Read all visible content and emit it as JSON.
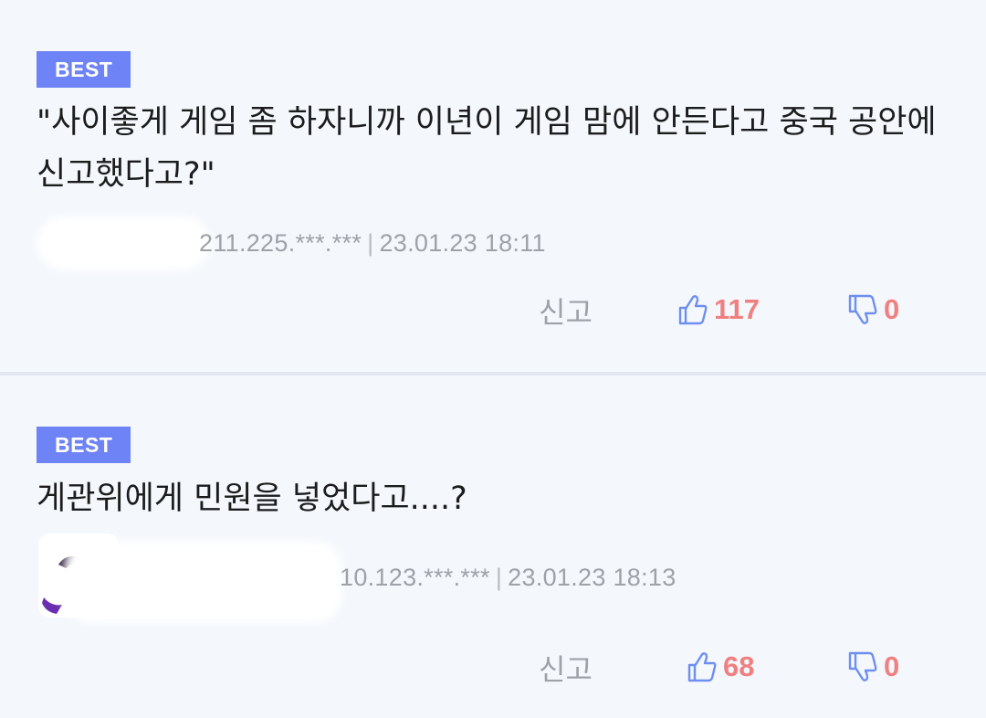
{
  "comments": [
    {
      "badge": "BEST",
      "text": "\"사이좋게 게임 좀 하자니까 이년이 게임 맘에 안든다고 중국 공안에 신고했다고?\"",
      "ip": "211.225.***.***",
      "separator": "|",
      "datetime": "23.01.23 18:11",
      "report_label": "신고",
      "likes": "117",
      "dislikes": "0"
    },
    {
      "badge": "BEST",
      "text": "게관위에게 민원을 넣었다고....?",
      "ip": "10.123.***.***",
      "separator": "|",
      "datetime": "23.01.23 18:13",
      "report_label": "신고",
      "likes": "68",
      "dislikes": "0"
    }
  ],
  "colors": {
    "badge": "#6e83f5",
    "like_icon": "#6e8ff0",
    "count": "#f08080",
    "meta": "#9ea2a8",
    "background": "#f4f7fc"
  },
  "icons": {
    "like": "thumbs-up-icon",
    "dislike": "thumbs-down-icon"
  }
}
